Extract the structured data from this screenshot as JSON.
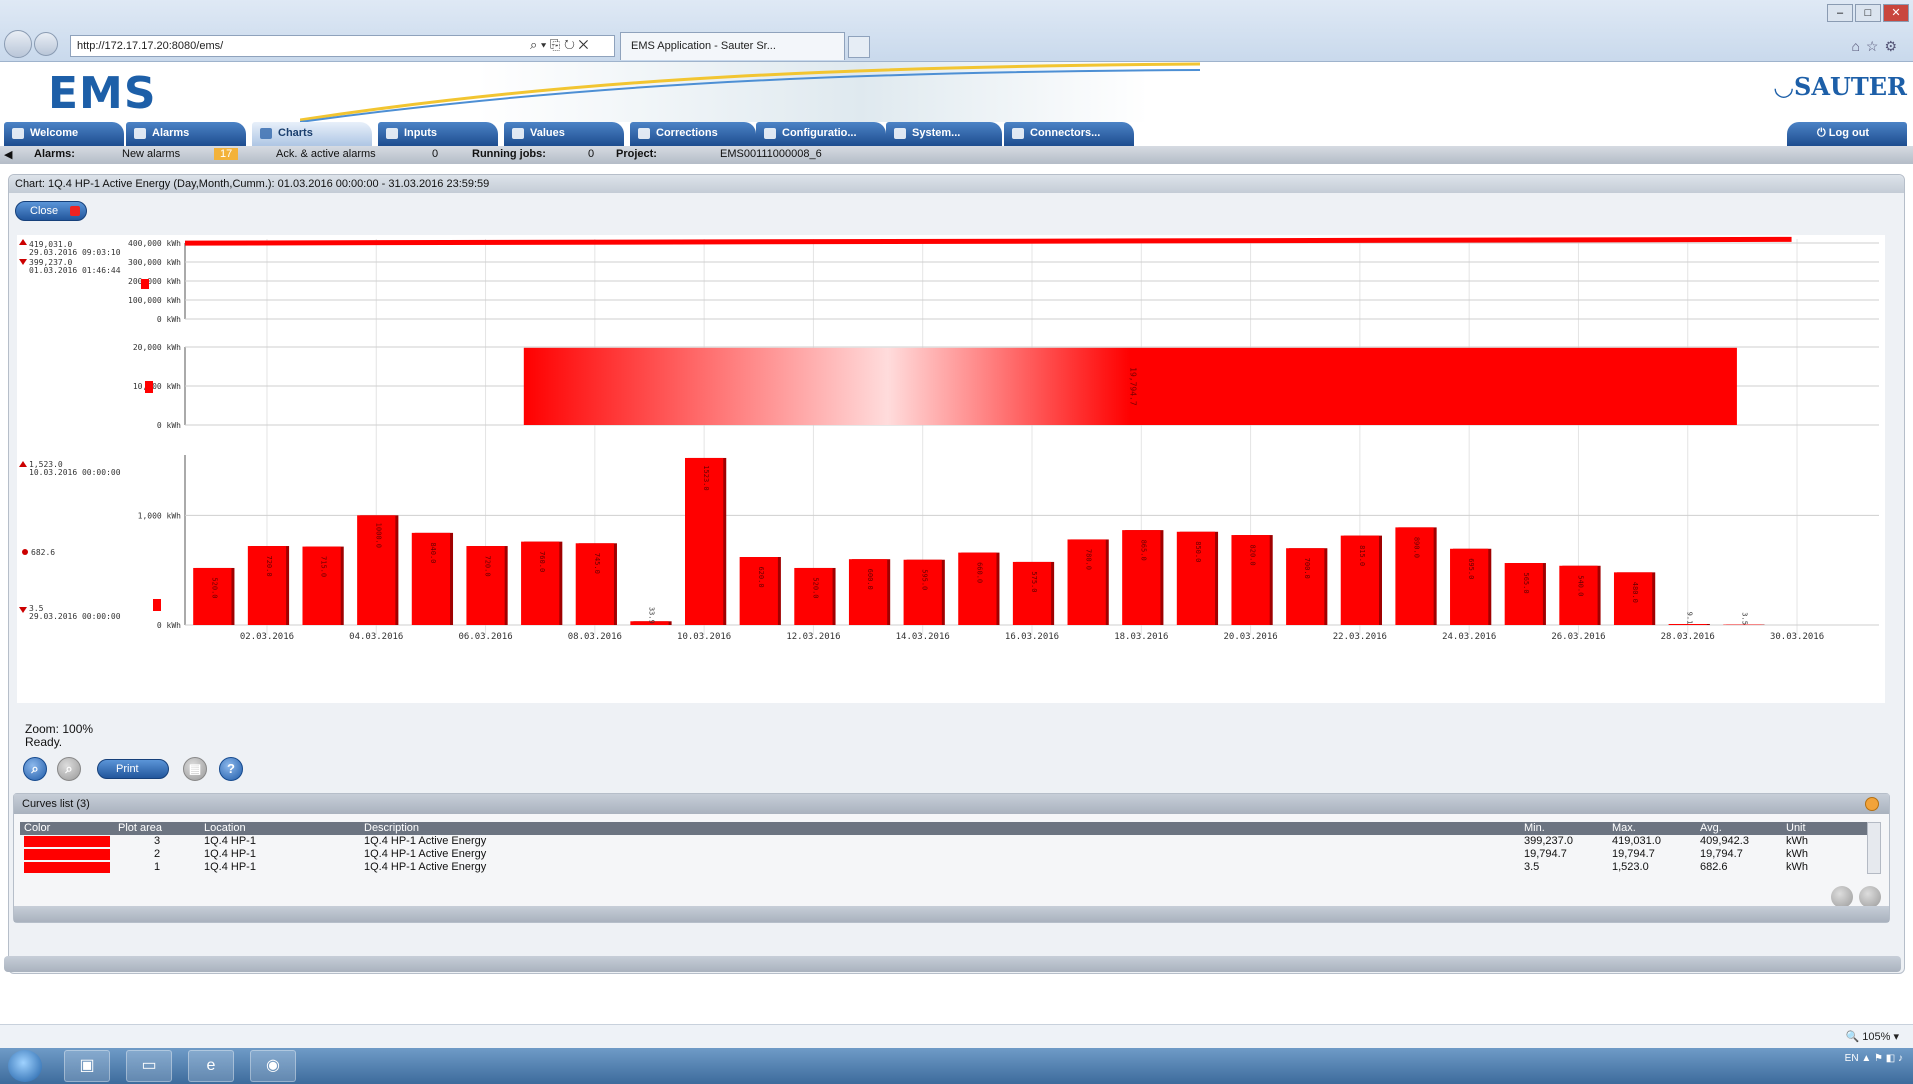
{
  "browser": {
    "url": "http://172.17.17.20:8080/ems/",
    "tab_title": "EMS Application - Sauter Sr...",
    "zoom": "105%"
  },
  "header": {
    "logo": "EMS",
    "brand": "SAUTER"
  },
  "tabs": [
    {
      "label": "Welcome"
    },
    {
      "label": "Alarms"
    },
    {
      "label": "Charts"
    },
    {
      "label": "Inputs"
    },
    {
      "label": "Values"
    },
    {
      "label": "Corrections"
    },
    {
      "label": "Configuratio..."
    },
    {
      "label": "System..."
    },
    {
      "label": "Connectors..."
    }
  ],
  "logout": "Log out",
  "status": {
    "alarms_label": "Alarms:",
    "new_alarms_label": "New alarms",
    "new_alarms_count": "17",
    "ack_label": "Ack. & active alarms",
    "ack_count": "0",
    "running_label": "Running jobs:",
    "running_count": "0",
    "project_label": "Project:",
    "project_value": "EMS00111000008_6"
  },
  "chart_panel": {
    "title": "Chart: 1Q.4 HP-1 Active Energy (Day,Month,Cumm.): 01.03.2016 00:00:00 - 31.03.2016 23:59:59",
    "close_label": "Close",
    "zoom_text": "Zoom: 100%",
    "ready_text": "Ready.",
    "print_label": "Print"
  },
  "chart_data": [
    {
      "type": "line",
      "plot_area": 3,
      "max_label": "419,031.0",
      "max_time": "29.03.2016 09:03:10",
      "min_label": "399,237.0",
      "min_time": "01.03.2016 01:46:44",
      "y_ticks": [
        "400,000 kWh",
        "300,000 kWh",
        "200,000 kWh",
        "100,000 kWh",
        "0 kWh"
      ],
      "ylim": [
        0,
        420000
      ],
      "start_value": 399237.0,
      "end_value": 419031.0
    },
    {
      "type": "bar",
      "plot_area": 2,
      "y_ticks": [
        "20,000 kWh",
        "10,000 kWh",
        "0 kWh"
      ],
      "ylim": [
        0,
        20000
      ],
      "value": 19794.7,
      "value_label": "19,794.7"
    },
    {
      "type": "bar",
      "plot_area": 1,
      "max_label": "1,523.0",
      "max_time": "10.03.2016 00:00:00",
      "avg_label": "682.6",
      "min_label": "3.5",
      "min_time": "29.03.2016 00:00:00",
      "y_ticks": [
        "1,000 kWh",
        "0 kWh"
      ],
      "ylim": [
        0,
        1600
      ],
      "x_ticks": [
        "02.03.2016",
        "04.03.2016",
        "06.03.2016",
        "08.03.2016",
        "10.03.2016",
        "12.03.2016",
        "14.03.2016",
        "16.03.2016",
        "18.03.2016",
        "20.03.2016",
        "22.03.2016",
        "24.03.2016",
        "26.03.2016",
        "28.03.2016",
        "30.03.2016"
      ],
      "values": [
        520,
        720,
        715,
        1000,
        840,
        720,
        760,
        745,
        33.9,
        1523,
        620,
        520,
        600,
        595,
        660,
        575,
        780,
        865,
        850,
        820,
        700,
        815,
        890,
        695,
        565,
        540,
        480,
        9.1,
        3.5
      ]
    }
  ],
  "curves": {
    "title": "Curves list (3)",
    "columns": [
      "Color",
      "Plot area",
      "Location",
      "Description",
      "Min.",
      "Max.",
      "Avg.",
      "Unit"
    ],
    "rows": [
      {
        "color": "#ff0000",
        "plot_area": "3",
        "location": "1Q.4 HP-1",
        "description": "1Q.4 HP-1 Active Energy",
        "min": "399,237.0",
        "max": "419,031.0",
        "avg": "409,942.3",
        "unit": "kWh"
      },
      {
        "color": "#ff0000",
        "plot_area": "2",
        "location": "1Q.4 HP-1",
        "description": "1Q.4 HP-1 Active Energy",
        "min": "19,794.7",
        "max": "19,794.7",
        "avg": "19,794.7",
        "unit": "kWh"
      },
      {
        "color": "#ff0000",
        "plot_area": "1",
        "location": "1Q.4 HP-1",
        "description": "1Q.4 HP-1 Active Energy",
        "min": "3.5",
        "max": "1,523.0",
        "avg": "682.6",
        "unit": "kWh"
      }
    ]
  }
}
